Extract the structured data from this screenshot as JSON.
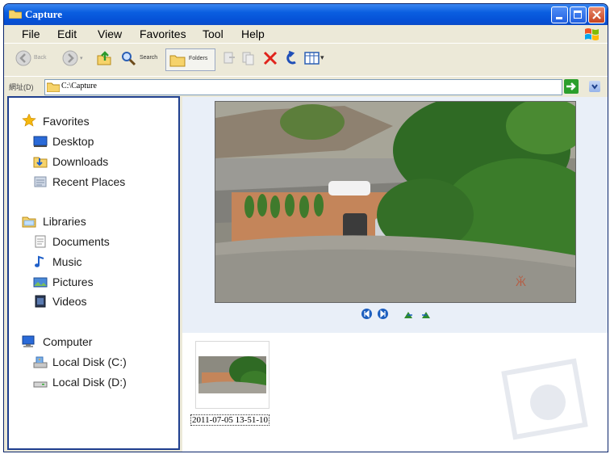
{
  "window": {
    "title": "Capture"
  },
  "menu": [
    "File",
    "Edit",
    "View",
    "Favorites",
    "Tool",
    "Help"
  ],
  "toolbar": {
    "back_label": "Back",
    "forward_label": "Forward",
    "search_label": "Search",
    "folders_label": "Folders"
  },
  "address": {
    "label": "網址(D)",
    "value": "C:\\Capture"
  },
  "nav": {
    "favorites": {
      "header": "Favorites",
      "items": [
        "Desktop",
        "Downloads",
        "Recent Places"
      ]
    },
    "libraries": {
      "header": "Libraries",
      "items": [
        "Documents",
        "Music",
        "Pictures",
        "Videos"
      ]
    },
    "computer": {
      "header": "Computer",
      "items": [
        "Local Disk (C:)",
        "Local Disk (D:)"
      ]
    }
  },
  "file": {
    "caption": "2011-07-05 13-51-10"
  },
  "icons": {
    "title": "folder-icon",
    "address": "folder-icon",
    "go": "go-arrow-icon",
    "favorites": "star-icon",
    "libraries": "library-folder-icon",
    "computer": "computer-icon"
  },
  "colors": {
    "titlebar": "#0a5ee0",
    "nav_border": "#1f3f8f",
    "preview_bg": "#e9eff8"
  }
}
